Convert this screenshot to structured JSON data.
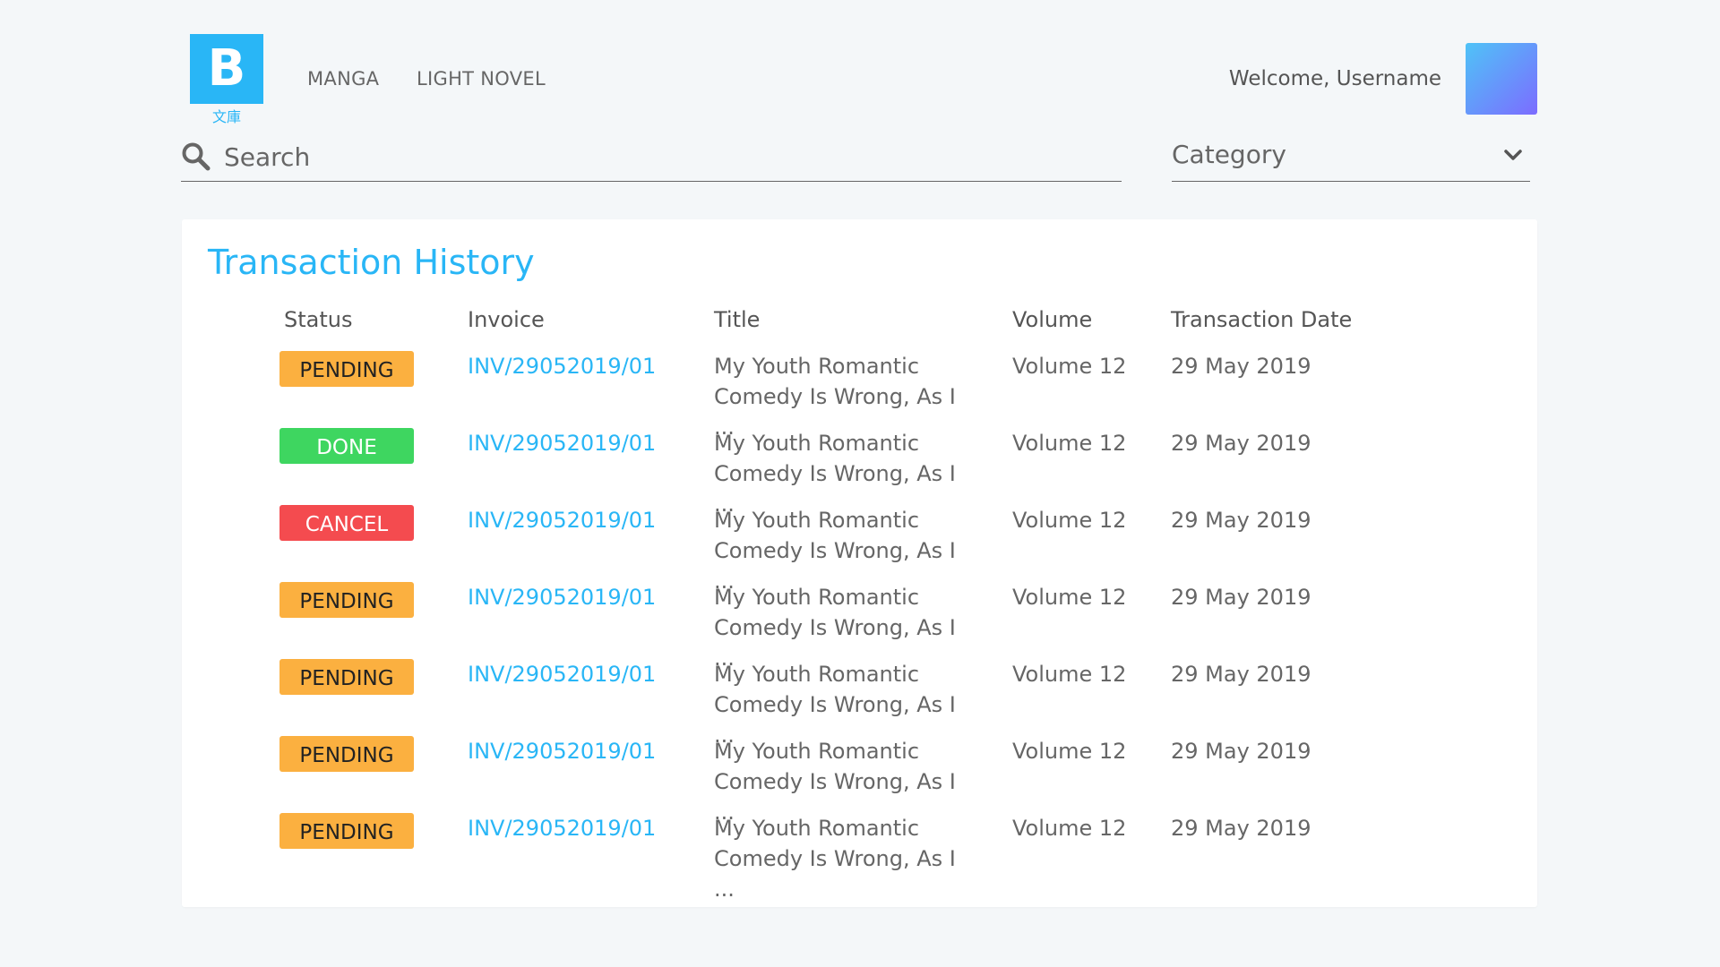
{
  "header": {
    "logo_letter": "B",
    "logo_sub": "文庫",
    "nav": [
      "MANGA",
      "LIGHT NOVEL"
    ],
    "welcome": "Welcome, Username"
  },
  "search": {
    "placeholder": "Search",
    "category_label": "Category"
  },
  "transactions": {
    "title": "Transaction History",
    "columns": [
      "Status",
      "Invoice",
      "Title",
      "Volume",
      "Transaction Date"
    ],
    "rows": [
      {
        "status": "PENDING",
        "invoice": "INV/29052019/01",
        "title_line1": "My Youth Romantic",
        "title_line2": "Comedy Is Wrong, As I ...",
        "volume": "Volume 12",
        "date": "29 May 2019"
      },
      {
        "status": "DONE",
        "invoice": "INV/29052019/01",
        "title_line1": "My Youth Romantic",
        "title_line2": "Comedy Is Wrong, As I ...",
        "volume": "Volume 12",
        "date": "29 May 2019"
      },
      {
        "status": "CANCEL",
        "invoice": "INV/29052019/01",
        "title_line1": "My Youth Romantic",
        "title_line2": "Comedy Is Wrong, As I ...",
        "volume": "Volume 12",
        "date": "29 May 2019"
      },
      {
        "status": "PENDING",
        "invoice": "INV/29052019/01",
        "title_line1": "My Youth Romantic",
        "title_line2": "Comedy Is Wrong, As I ...",
        "volume": "Volume 12",
        "date": "29 May 2019"
      },
      {
        "status": "PENDING",
        "invoice": "INV/29052019/01",
        "title_line1": "My Youth Romantic",
        "title_line2": "Comedy Is Wrong, As I ...",
        "volume": "Volume 12",
        "date": "29 May 2019"
      },
      {
        "status": "PENDING",
        "invoice": "INV/29052019/01",
        "title_line1": "My Youth Romantic",
        "title_line2": "Comedy Is Wrong, As I ...",
        "volume": "Volume 12",
        "date": "29 May 2019"
      },
      {
        "status": "PENDING",
        "invoice": "INV/29052019/01",
        "title_line1": "My Youth Romantic",
        "title_line2": "Comedy Is Wrong, As I ...",
        "volume": "Volume 12",
        "date": "29 May 2019"
      }
    ]
  },
  "colors": {
    "accent": "#29b6f6",
    "pending": "#fbb040",
    "done": "#3ed660",
    "cancel": "#f44b4f",
    "background": "#f4f7f9"
  },
  "icons": {
    "search": "search-icon",
    "dropdown": "chevron-down-icon"
  }
}
